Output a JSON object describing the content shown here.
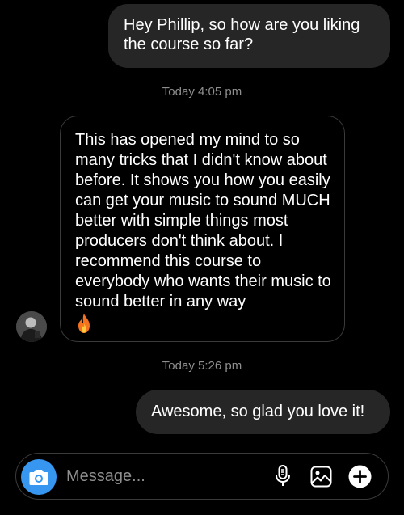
{
  "conversation": {
    "messages": [
      {
        "direction": "outgoing",
        "text": "Hey Phillip, so how are you liking the course so far?"
      },
      {
        "timestamp": "Today 4:05 pm"
      },
      {
        "direction": "incoming",
        "text": "This has opened my mind to so many tricks that I didn't know about before. It shows you how you easily can get your music to sound MUCH better with simple things most producers don't think about. I recommend this course to everybody who wants their music to sound better in any way",
        "emoji": "fire-emoji"
      },
      {
        "timestamp": "Today 5:26 pm"
      },
      {
        "direction": "outgoing",
        "text": "Awesome, so glad you love it!"
      }
    ]
  },
  "composer": {
    "placeholder": "Message...",
    "value": "",
    "icons": [
      "camera-icon",
      "microphone-icon",
      "image-icon",
      "plus-icon"
    ]
  },
  "colors": {
    "background": "#000000",
    "outgoing_bubble": "#262626",
    "incoming_border": "#3a3a3a",
    "timestamp": "#8e8e8e",
    "camera_button": "#3797f0",
    "fire": "#f5731f"
  }
}
